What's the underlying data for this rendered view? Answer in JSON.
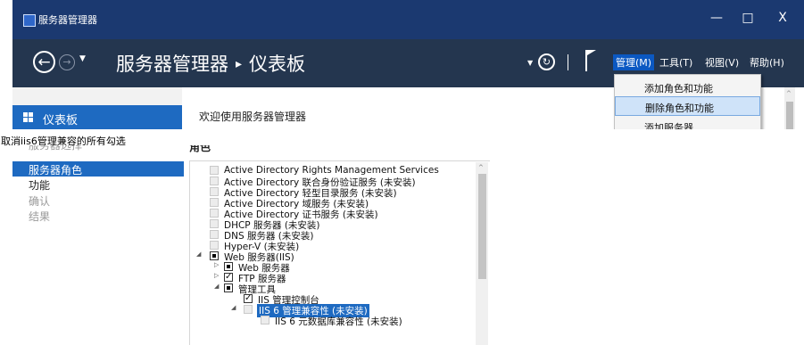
{
  "window": {
    "title": "服务器管理器",
    "controls": {
      "minimize": "—",
      "maximize": "□",
      "close": "X"
    }
  },
  "nav": {
    "back": "←",
    "forward": "→",
    "history": "▼",
    "breadcrumb_root": "服务器管理器",
    "breadcrumb_sep": "▸",
    "breadcrumb_current": "仪表板",
    "refresh_dropdown": "▼",
    "refresh": "↻",
    "menus": {
      "manage": "管理(M)",
      "tools": "工具(T)",
      "view": "视图(V)",
      "help": "帮助(H)"
    }
  },
  "manage_menu": {
    "items": [
      "添加角色和功能",
      "删除角色和功能",
      "添加服务器"
    ]
  },
  "sidebar": {
    "dashboard": "仪表板"
  },
  "main": {
    "welcome": "欢迎使用服务器管理器",
    "scroll_up": "^"
  },
  "caption": "取消iis6管理兼容的所有勾选",
  "wizard": {
    "steps": [
      "服务器选择",
      "服务器角色",
      "功能",
      "确认",
      "结果"
    ],
    "roles_heading": "角色",
    "roles": [
      "Active Directory Rights Management Services",
      "Active Directory 联合身份验证服务 (未安装)",
      "Active Directory 轻型目录服务 (未安装)",
      "Active Directory 域服务 (未安装)",
      "Active Directory 证书服务 (未安装)",
      "DHCP 服务器 (未安装)",
      "DNS 服务器 (未安装)",
      "Hyper-V (未安装)",
      "Web 服务器(IIS)",
      "Web 服务器",
      "FTP 服务器",
      "管理工具",
      "IIS 管理控制台",
      "IIS 6 管理兼容性 (未安装)",
      "IIS 6 元数据库兼容性 (未安装)"
    ],
    "scroll_up": "^",
    "expander_open": "◢",
    "expander_closed": "▷",
    "check": "✓"
  }
}
